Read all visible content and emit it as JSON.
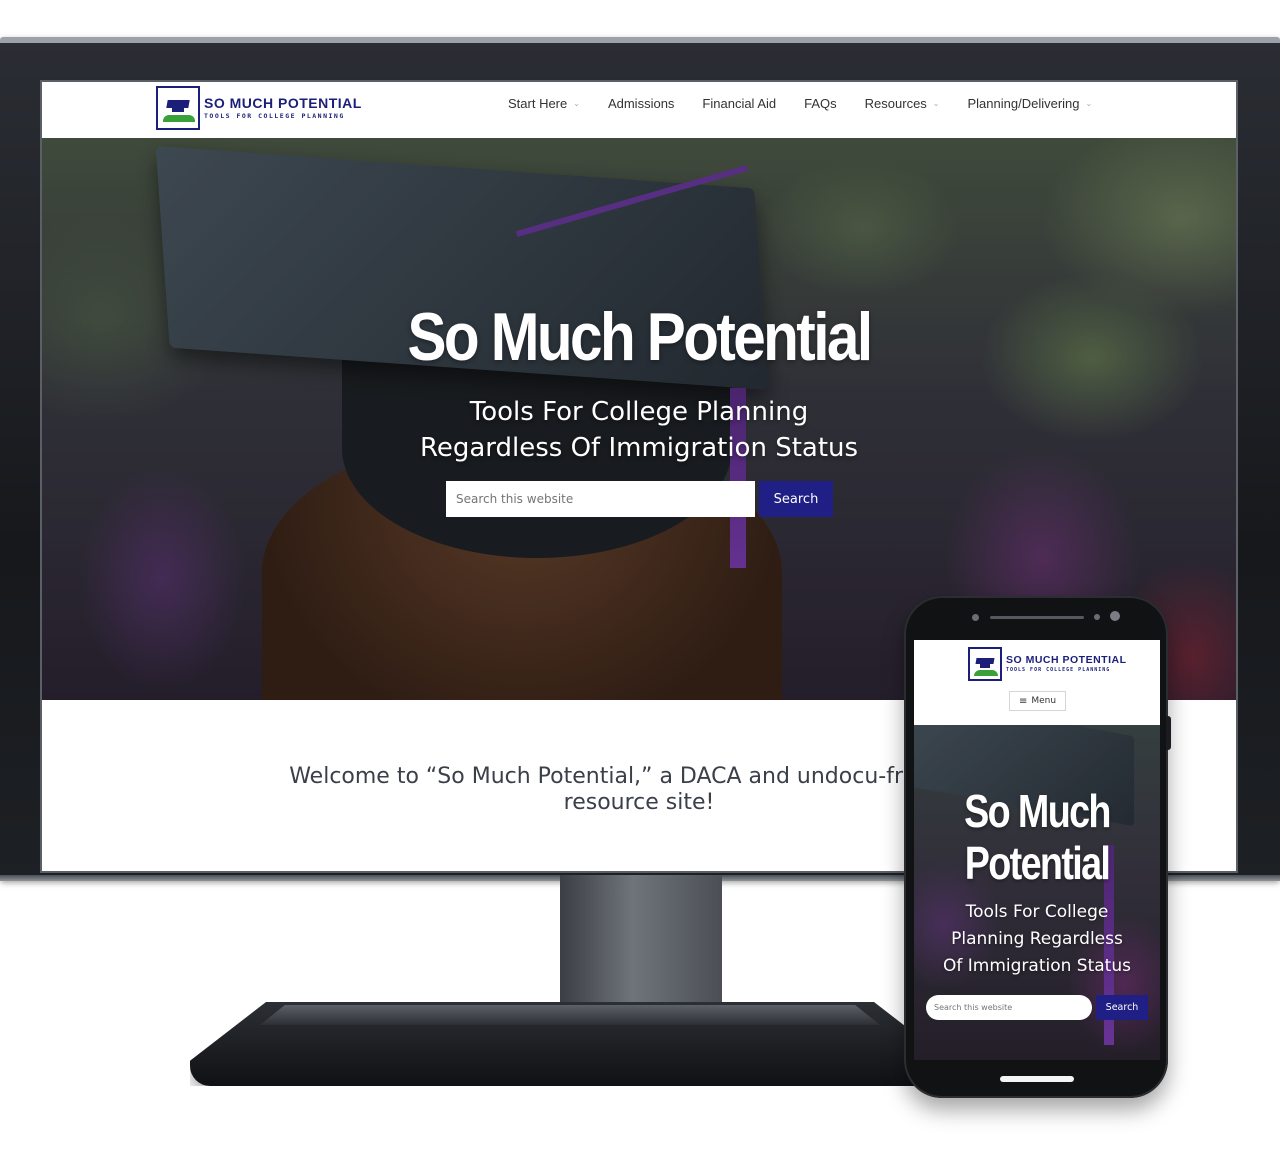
{
  "desktop": {
    "logo": {
      "title": "SO MUCH POTENTIAL",
      "subtitle": "TOOLS FOR COLLEGE PLANNING"
    },
    "nav": [
      {
        "label": "Start Here",
        "has_dropdown": true
      },
      {
        "label": "Admissions",
        "has_dropdown": false
      },
      {
        "label": "Financial Aid",
        "has_dropdown": false
      },
      {
        "label": "FAQs",
        "has_dropdown": false
      },
      {
        "label": "Resources",
        "has_dropdown": true
      },
      {
        "label": "Planning/Delivering",
        "has_dropdown": true
      }
    ],
    "hero": {
      "title": "So Much Potential",
      "subtitle_line1": "Tools For College Planning",
      "subtitle_line2": "Regardless Of Immigration Status",
      "search_placeholder": "Search this website",
      "search_button": "Search"
    },
    "welcome_line1": "Welcome to “So Much Potential,” a DACA and undocu-friendly c",
    "welcome_line2": "resource site!"
  },
  "mobile": {
    "logo": {
      "title": "SO MUCH POTENTIAL",
      "subtitle": "TOOLS FOR COLLEGE PLANNING"
    },
    "menu_label": "Menu",
    "hero": {
      "title_line1": "So Much",
      "title_line2": "Potential",
      "subtitle_line1": "Tools For College",
      "subtitle_line2": "Planning Regardless",
      "subtitle_line3": "Of Immigration Status",
      "search_placeholder": "Search this website",
      "search_button": "Search"
    }
  },
  "colors": {
    "brand_navy": "#1b1f7a",
    "button_blue": "#1f1f85",
    "logo_green": "#3aa13a",
    "tassel_purple": "#6a3aa0"
  },
  "icons": [
    "graduation-cap-icon",
    "chevron-down-icon",
    "hamburger-icon"
  ]
}
